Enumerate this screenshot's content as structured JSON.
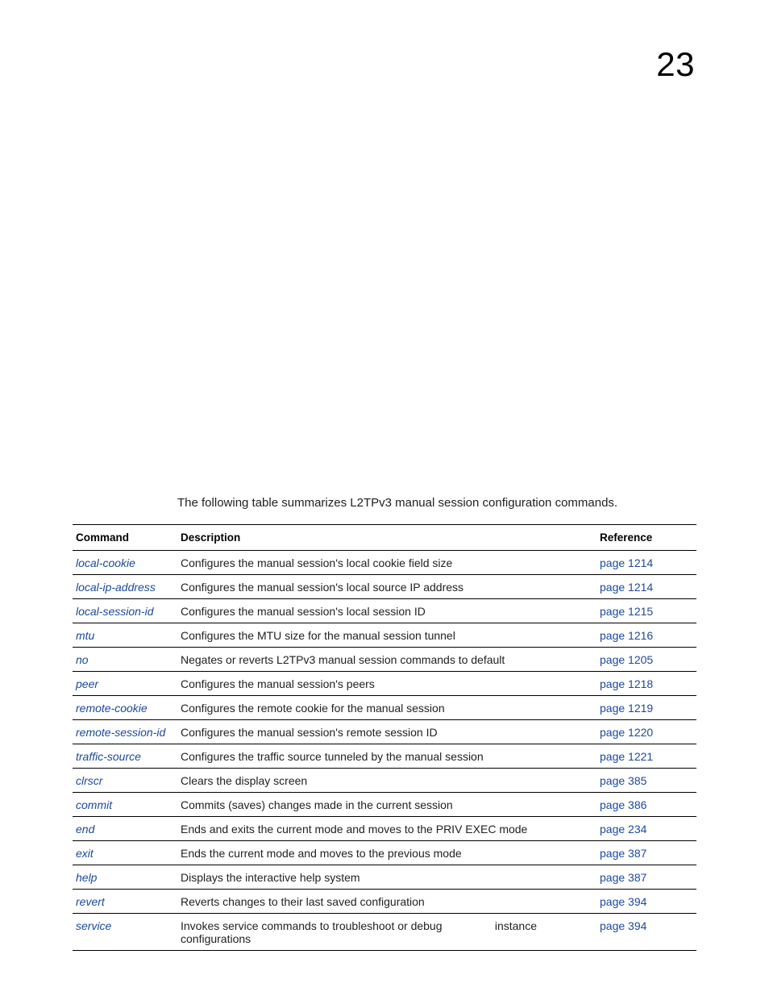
{
  "page_number": "23",
  "intro_text": "The following table summarizes L2TPv3 manual session configuration commands.",
  "headers": {
    "command": "Command",
    "description": "Description",
    "reference": "Reference"
  },
  "rows": [
    {
      "command": "local-cookie",
      "description": "Configures the manual session's local cookie field size",
      "reference": "page 1214"
    },
    {
      "command": "local-ip-address",
      "description": "Configures the manual session's local source IP address",
      "reference": "page 1214"
    },
    {
      "command": "local-session-id",
      "description": "Configures the manual session's local session ID",
      "reference": "page 1215"
    },
    {
      "command": "mtu",
      "description": "Configures the MTU size for the manual session tunnel",
      "reference": "page 1216"
    },
    {
      "command": "no",
      "description": "Negates or reverts L2TPv3 manual session commands to default",
      "reference": "page 1205"
    },
    {
      "command": "peer",
      "description": "Configures the manual session's peers",
      "reference": "page 1218"
    },
    {
      "command": "remote-cookie",
      "description": "Configures the remote cookie for the manual session",
      "reference": "page 1219"
    },
    {
      "command": "remote-session-id",
      "description": "Configures the manual session's remote session ID",
      "reference": "page 1220"
    },
    {
      "command": "traffic-source",
      "description": "Configures the traffic source tunneled by the manual session",
      "reference": "page 1221"
    },
    {
      "command": "clrscr",
      "description": "Clears the display screen",
      "reference": "page 385"
    },
    {
      "command": "commit",
      "description": "Commits (saves) changes made in the current session",
      "reference": "page 386"
    },
    {
      "command": "end",
      "description": "Ends and exits the current mode and moves to the PRIV EXEC mode",
      "reference": "page 234"
    },
    {
      "command": "exit",
      "description": "Ends the current mode and moves to the previous mode",
      "reference": "page 387"
    },
    {
      "command": "help",
      "description": "Displays the interactive help system",
      "reference": "page 387"
    },
    {
      "command": "revert",
      "description": "Reverts changes to their last saved configuration",
      "reference": "page 394"
    },
    {
      "command": "service",
      "description": "Invokes service commands to troubleshoot or debug configurations",
      "description_extra": "instance",
      "reference": "page 394"
    }
  ]
}
